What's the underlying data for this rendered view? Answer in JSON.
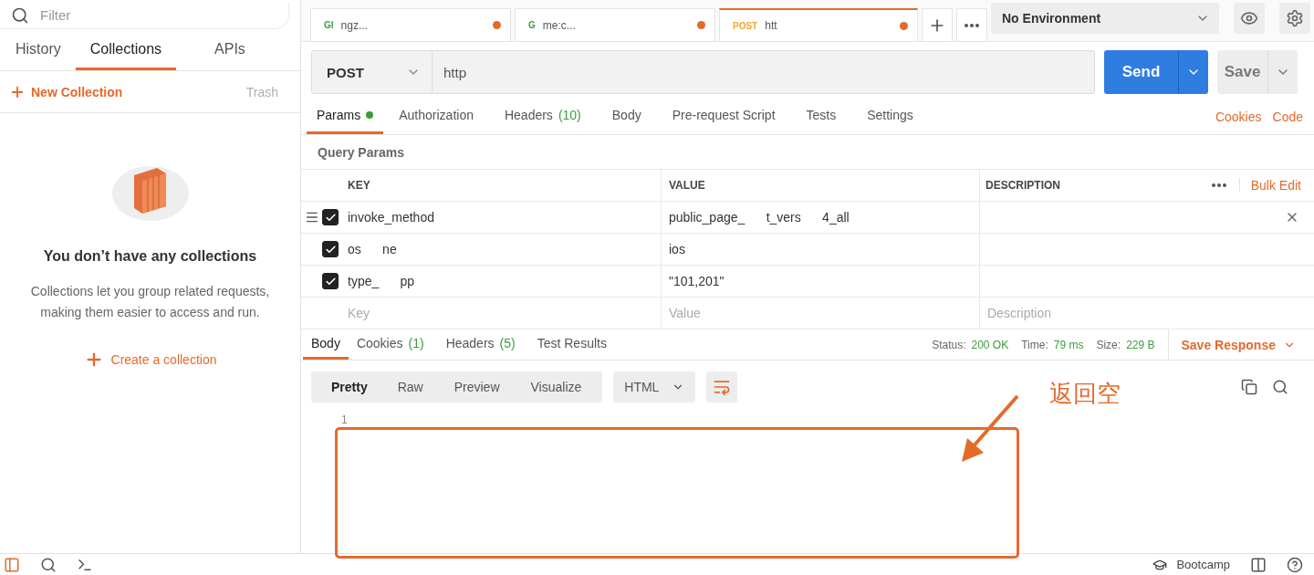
{
  "sidebar": {
    "search": {
      "placeholder": "Filter"
    },
    "tabs": [
      {
        "label": "History",
        "selected": false
      },
      {
        "label": "Collections",
        "selected": true
      },
      {
        "label": "APIs",
        "selected": false
      }
    ],
    "new_collection": "New Collection",
    "trash": "Trash",
    "empty": {
      "title": "You don’t have any collections",
      "text": "Collections let you group related requests, making them easier to access and run.",
      "action": "Create a collection"
    }
  },
  "request_tabs": [
    {
      "method": "Gl",
      "title": "ngz...",
      "unsaved": true,
      "selected": false
    },
    {
      "method": "G",
      "title": "me:c...",
      "unsaved": true,
      "selected": false
    },
    {
      "method": "POST",
      "title": "htt",
      "unsaved": true,
      "selected": true
    }
  ],
  "environment": "No Environment",
  "request": {
    "method": "POST",
    "url": "http",
    "send": "Send",
    "save": "Save"
  },
  "request_sections": [
    {
      "label": "Params",
      "dot": true,
      "selected": true
    },
    {
      "label": "Authorization",
      "selected": false
    },
    {
      "label": "Headers",
      "count": "(10)",
      "selected": false
    },
    {
      "label": "Body",
      "selected": false
    },
    {
      "label": "Pre-request Script",
      "selected": false
    },
    {
      "label": "Tests",
      "selected": false
    },
    {
      "label": "Settings",
      "selected": false
    }
  ],
  "links": [
    "Cookies",
    "Code"
  ],
  "query_params": {
    "title": "Query Params",
    "columns": [
      "KEY",
      "VALUE",
      "DESCRIPTION"
    ],
    "bulk_edit": "Bulk Edit",
    "rows": [
      {
        "key": "invoke_method",
        "value": "public_page_      t_vers      4_all",
        "checked": true
      },
      {
        "key": "os      ne",
        "value": "ios",
        "checked": true
      },
      {
        "key": "type_      pp",
        "value": "\"101,201\"",
        "checked": true
      }
    ],
    "placeholders": [
      "Key",
      "Value",
      "Description"
    ]
  },
  "response": {
    "tabs": [
      {
        "label": "Body",
        "selected": true
      },
      {
        "label": "Cookies",
        "count": "(1)",
        "selected": false
      },
      {
        "label": "Headers",
        "count": "(5)",
        "selected": false
      },
      {
        "label": "Test Results",
        "selected": false
      }
    ],
    "stats": [
      {
        "label": "Status:",
        "value": "200 OK"
      },
      {
        "label": "Time:",
        "value": "79 ms"
      },
      {
        "label": "Size:",
        "value": "229 B"
      }
    ],
    "save_response": "Save Response",
    "views": [
      {
        "label": "Pretty",
        "selected": true
      },
      {
        "label": "Raw",
        "selected": false
      },
      {
        "label": "Preview",
        "selected": false
      },
      {
        "label": "Visualize",
        "selected": false
      }
    ],
    "format": "HTML",
    "line_numbers": [
      "1"
    ]
  },
  "annotation": "返回空",
  "status_bar": {
    "bootcamp": "Bootcamp"
  }
}
